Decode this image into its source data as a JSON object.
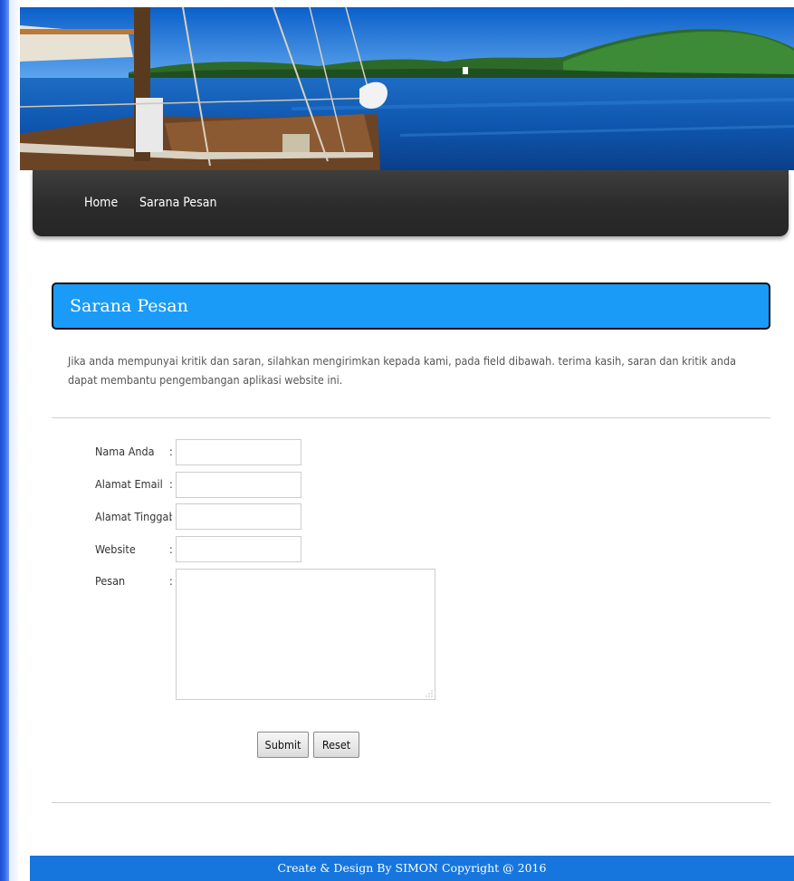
{
  "nav": {
    "home_label": "Home",
    "sarana_label": "Sarana Pesan"
  },
  "section": {
    "title": "Sarana Pesan",
    "intro": "Jika anda mempunyai kritik dan saran, silahkan mengirimkan kepada kami, pada field dibawah. terima kasih, saran dan kritik anda dapat membantu pengembangan aplikasi website ini."
  },
  "form": {
    "fields": [
      {
        "label": "Nama Anda",
        "colon": ":",
        "value": ""
      },
      {
        "label": "Alamat Email",
        "colon": ":",
        "value": ""
      },
      {
        "label": "Alamat Tinggal",
        "colon": ":",
        "value": ""
      },
      {
        "label": "Website",
        "colon": ":",
        "value": ""
      }
    ],
    "message": {
      "label": "Pesan",
      "colon": ":",
      "value": ""
    },
    "submit_label": "Submit",
    "reset_label": "Reset"
  },
  "footer": {
    "text": "Create & Design By SIMON Copyright @ 2016"
  },
  "colors": {
    "title_bar": "#1a9bf7",
    "navbar": "#2b2b2b",
    "footer": "#1676de",
    "left_strip": "#2f66e8"
  },
  "icons": {
    "banner": "sailboat-harbor-banner-image",
    "textarea_grip": "resize-grip-icon"
  }
}
